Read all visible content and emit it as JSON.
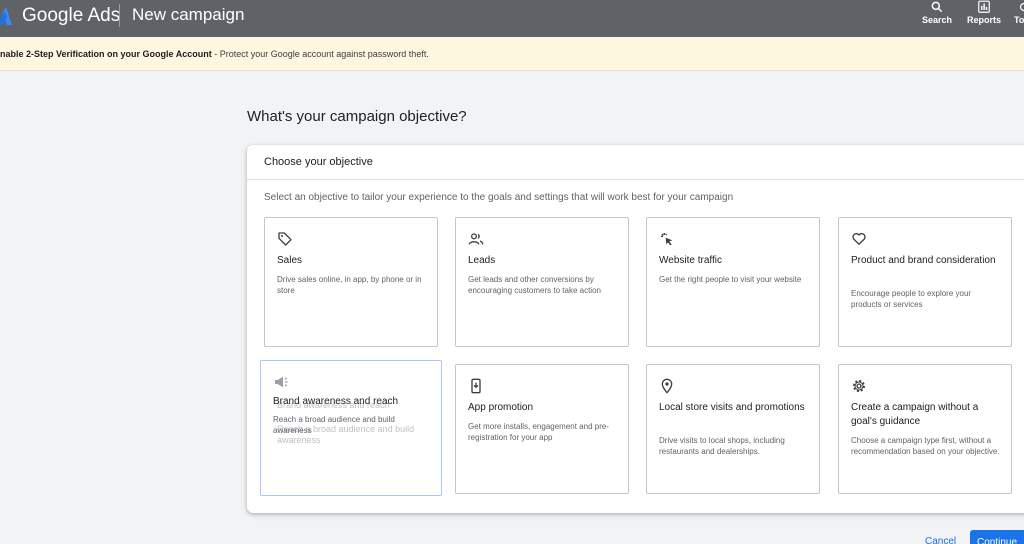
{
  "header": {
    "brand": "Google Ads",
    "title": "New campaign",
    "tools": [
      {
        "label": "Search",
        "icon": "search-icon"
      },
      {
        "label": "Reports",
        "icon": "reports-icon"
      },
      {
        "label": "To",
        "icon": "tools-icon"
      }
    ]
  },
  "banner": {
    "bold": "nable 2-Step Verification on your Google Account",
    "text": " - Protect your Google account against password theft."
  },
  "main": {
    "heading": "What's your campaign objective?",
    "panel_title": "Choose your objective",
    "panel_description": "Select an objective to tailor your experience to the goals and settings that will work best for your campaign",
    "objectives": [
      {
        "title": "Sales",
        "description": "Drive sales online, in app, by phone or in store",
        "icon": "tag-icon"
      },
      {
        "title": "Leads",
        "description": "Get leads and other conversions by encouraging customers to take action",
        "icon": "people-icon"
      },
      {
        "title": "Website traffic",
        "description": "Get the right people to visit your website",
        "icon": "cursor-click-icon"
      },
      {
        "title": "Product and brand consideration",
        "description": "Encourage people to explore your products or services",
        "icon": "heart-icon"
      },
      {
        "title": "Brand awareness and reach",
        "description": "Reach a broad audience and build awareness",
        "icon": "megaphone-icon"
      },
      {
        "title": "App promotion",
        "description": "Get more installs, engagement and pre-registration for your app",
        "icon": "phone-download-icon"
      },
      {
        "title": "Local store visits and promotions",
        "description": "Drive visits to local shops, including restaurants and dealerships.",
        "icon": "location-pin-icon"
      },
      {
        "title": "Create a campaign without a goal's guidance",
        "description": "Choose a campaign type first, without a recommendation based on your objective.",
        "icon": "gear-icon"
      }
    ]
  },
  "footer": {
    "cancel": "Cancel",
    "continue": "Continue"
  },
  "colors": {
    "header_bg": "#5f6368",
    "banner_bg": "#fef7e0",
    "accent": "#1a73e8"
  }
}
